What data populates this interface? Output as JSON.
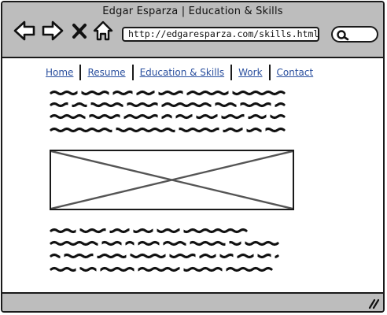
{
  "window": {
    "title": "Edgar Esparza | Education & Skills"
  },
  "toolbar": {
    "back_icon": "arrow-left-icon",
    "forward_icon": "arrow-right-icon",
    "stop_icon": "close-icon",
    "home_icon": "home-icon",
    "address_value": "http://edgaresparza.com/skills.html",
    "search_icon": "search-icon"
  },
  "menu": {
    "items": [
      {
        "label": "Home"
      },
      {
        "label": "Resume"
      },
      {
        "label": "Education & Skills"
      },
      {
        "label": "Work"
      },
      {
        "label": "Contact"
      }
    ]
  },
  "content": {
    "image_placeholder_icon": "image-placeholder-icon",
    "paragraph_1_lines": 4,
    "paragraph_2_lines": 4
  },
  "colors": {
    "chrome": "#bdbdbd",
    "link": "#2a4f9e",
    "stroke": "#1a1a1a"
  }
}
